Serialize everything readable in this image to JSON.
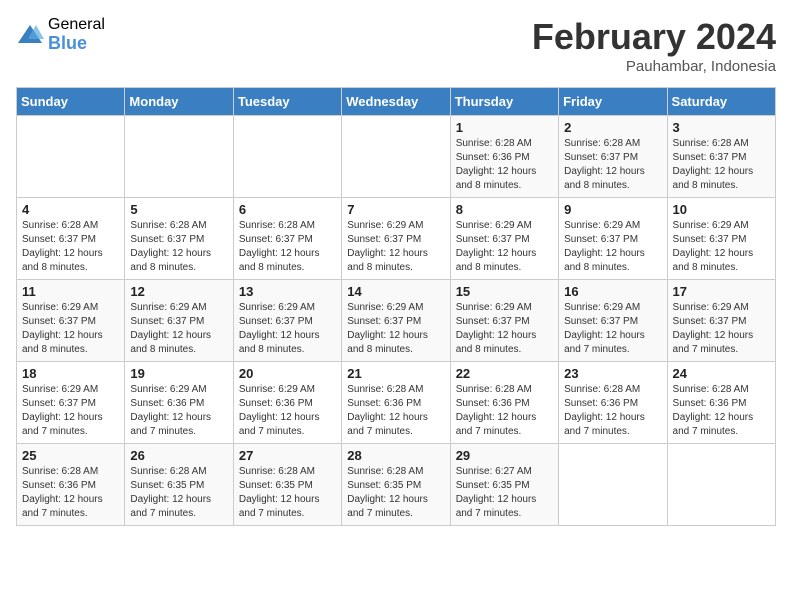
{
  "logo": {
    "general": "General",
    "blue": "Blue"
  },
  "title": "February 2024",
  "location": "Pauhambar, Indonesia",
  "days_of_week": [
    "Sunday",
    "Monday",
    "Tuesday",
    "Wednesday",
    "Thursday",
    "Friday",
    "Saturday"
  ],
  "weeks": [
    [
      {
        "day": "",
        "info": ""
      },
      {
        "day": "",
        "info": ""
      },
      {
        "day": "",
        "info": ""
      },
      {
        "day": "",
        "info": ""
      },
      {
        "day": "1",
        "info": "Sunrise: 6:28 AM\nSunset: 6:36 PM\nDaylight: 12 hours and 8 minutes."
      },
      {
        "day": "2",
        "info": "Sunrise: 6:28 AM\nSunset: 6:37 PM\nDaylight: 12 hours and 8 minutes."
      },
      {
        "day": "3",
        "info": "Sunrise: 6:28 AM\nSunset: 6:37 PM\nDaylight: 12 hours and 8 minutes."
      }
    ],
    [
      {
        "day": "4",
        "info": "Sunrise: 6:28 AM\nSunset: 6:37 PM\nDaylight: 12 hours and 8 minutes."
      },
      {
        "day": "5",
        "info": "Sunrise: 6:28 AM\nSunset: 6:37 PM\nDaylight: 12 hours and 8 minutes."
      },
      {
        "day": "6",
        "info": "Sunrise: 6:28 AM\nSunset: 6:37 PM\nDaylight: 12 hours and 8 minutes."
      },
      {
        "day": "7",
        "info": "Sunrise: 6:29 AM\nSunset: 6:37 PM\nDaylight: 12 hours and 8 minutes."
      },
      {
        "day": "8",
        "info": "Sunrise: 6:29 AM\nSunset: 6:37 PM\nDaylight: 12 hours and 8 minutes."
      },
      {
        "day": "9",
        "info": "Sunrise: 6:29 AM\nSunset: 6:37 PM\nDaylight: 12 hours and 8 minutes."
      },
      {
        "day": "10",
        "info": "Sunrise: 6:29 AM\nSunset: 6:37 PM\nDaylight: 12 hours and 8 minutes."
      }
    ],
    [
      {
        "day": "11",
        "info": "Sunrise: 6:29 AM\nSunset: 6:37 PM\nDaylight: 12 hours and 8 minutes."
      },
      {
        "day": "12",
        "info": "Sunrise: 6:29 AM\nSunset: 6:37 PM\nDaylight: 12 hours and 8 minutes."
      },
      {
        "day": "13",
        "info": "Sunrise: 6:29 AM\nSunset: 6:37 PM\nDaylight: 12 hours and 8 minutes."
      },
      {
        "day": "14",
        "info": "Sunrise: 6:29 AM\nSunset: 6:37 PM\nDaylight: 12 hours and 8 minutes."
      },
      {
        "day": "15",
        "info": "Sunrise: 6:29 AM\nSunset: 6:37 PM\nDaylight: 12 hours and 8 minutes."
      },
      {
        "day": "16",
        "info": "Sunrise: 6:29 AM\nSunset: 6:37 PM\nDaylight: 12 hours and 7 minutes."
      },
      {
        "day": "17",
        "info": "Sunrise: 6:29 AM\nSunset: 6:37 PM\nDaylight: 12 hours and 7 minutes."
      }
    ],
    [
      {
        "day": "18",
        "info": "Sunrise: 6:29 AM\nSunset: 6:37 PM\nDaylight: 12 hours and 7 minutes."
      },
      {
        "day": "19",
        "info": "Sunrise: 6:29 AM\nSunset: 6:36 PM\nDaylight: 12 hours and 7 minutes."
      },
      {
        "day": "20",
        "info": "Sunrise: 6:29 AM\nSunset: 6:36 PM\nDaylight: 12 hours and 7 minutes."
      },
      {
        "day": "21",
        "info": "Sunrise: 6:28 AM\nSunset: 6:36 PM\nDaylight: 12 hours and 7 minutes."
      },
      {
        "day": "22",
        "info": "Sunrise: 6:28 AM\nSunset: 6:36 PM\nDaylight: 12 hours and 7 minutes."
      },
      {
        "day": "23",
        "info": "Sunrise: 6:28 AM\nSunset: 6:36 PM\nDaylight: 12 hours and 7 minutes."
      },
      {
        "day": "24",
        "info": "Sunrise: 6:28 AM\nSunset: 6:36 PM\nDaylight: 12 hours and 7 minutes."
      }
    ],
    [
      {
        "day": "25",
        "info": "Sunrise: 6:28 AM\nSunset: 6:36 PM\nDaylight: 12 hours and 7 minutes."
      },
      {
        "day": "26",
        "info": "Sunrise: 6:28 AM\nSunset: 6:35 PM\nDaylight: 12 hours and 7 minutes."
      },
      {
        "day": "27",
        "info": "Sunrise: 6:28 AM\nSunset: 6:35 PM\nDaylight: 12 hours and 7 minutes."
      },
      {
        "day": "28",
        "info": "Sunrise: 6:28 AM\nSunset: 6:35 PM\nDaylight: 12 hours and 7 minutes."
      },
      {
        "day": "29",
        "info": "Sunrise: 6:27 AM\nSunset: 6:35 PM\nDaylight: 12 hours and 7 minutes."
      },
      {
        "day": "",
        "info": ""
      },
      {
        "day": "",
        "info": ""
      }
    ]
  ]
}
